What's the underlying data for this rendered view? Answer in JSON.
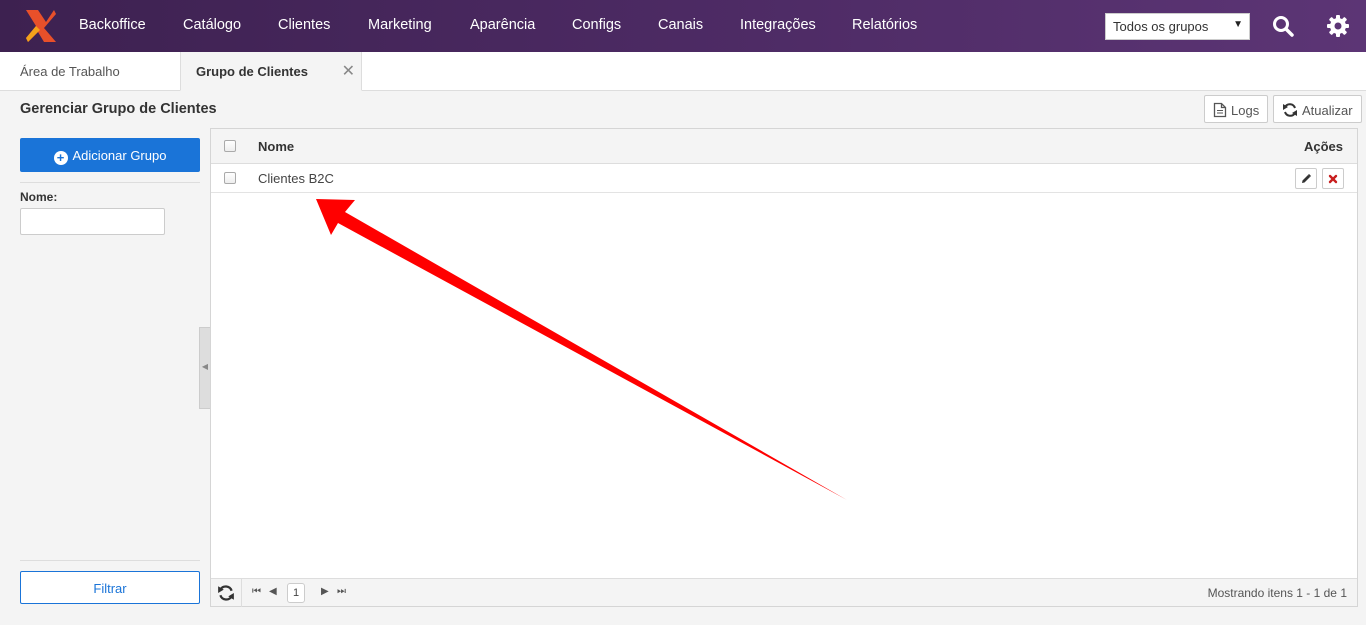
{
  "nav": {
    "items": [
      "Backoffice",
      "Catálogo",
      "Clientes",
      "Marketing",
      "Aparência",
      "Configs",
      "Canais",
      "Integrações",
      "Relatórios"
    ],
    "group_select": "Todos os grupos"
  },
  "tabs": [
    {
      "label": "Área de Trabalho"
    },
    {
      "label": "Grupo de Clientes",
      "active": true
    }
  ],
  "page": {
    "title": "Gerenciar Grupo de Clientes",
    "logs_label": "Logs",
    "refresh_label": "Atualizar"
  },
  "sidebar": {
    "add_label": "Adicionar Grupo",
    "name_label": "Nome:",
    "name_value": "",
    "filter_label": "Filtrar"
  },
  "grid": {
    "columns": {
      "name": "Nome",
      "actions": "Ações"
    },
    "rows": [
      {
        "name": "Clientes B2C"
      }
    ],
    "page": "1",
    "info": "Mostrando itens 1 - 1 de 1"
  },
  "colors": {
    "nav_bg": "#4c2a63",
    "primary": "#1a74d8",
    "annotation": "#ff0000"
  }
}
